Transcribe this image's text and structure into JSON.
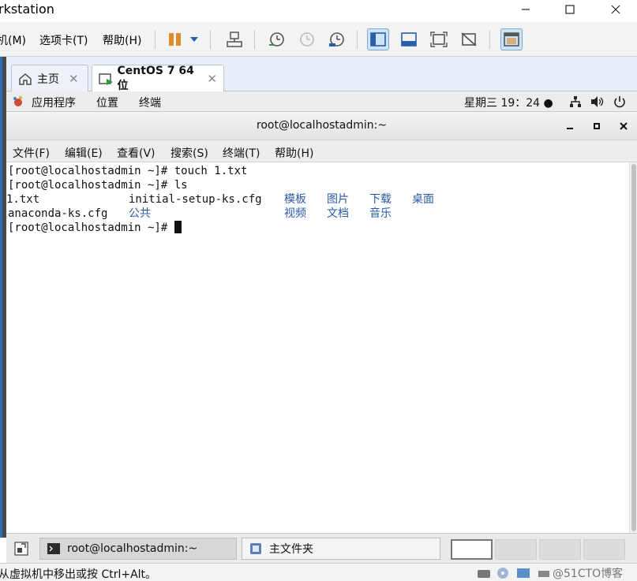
{
  "window": {
    "title": "rkstation"
  },
  "vm_menu": [
    "机(M)",
    "选项卡(T)",
    "帮助(H)"
  ],
  "tabs": [
    {
      "label": "主页"
    },
    {
      "label": "CentOS 7 64 位"
    }
  ],
  "gnome_top": {
    "apps": "应用程序",
    "places": "位置",
    "terminal": "终端",
    "clock": "星期三 19：24 ●"
  },
  "terminal": {
    "title": "root@localhostadmin:~",
    "menu": [
      "文件(F)",
      "编辑(E)",
      "查看(V)",
      "搜索(S)",
      "终端(T)",
      "帮助(H)"
    ],
    "lines": [
      {
        "prompt": "[root@localhostadmin ~]# ",
        "cmd": "touch 1.txt"
      },
      {
        "prompt": "[root@localhostadmin ~]# ",
        "cmd": "ls"
      }
    ],
    "ls_output": {
      "row1": {
        "a": "1.txt",
        "b": "initial-setup-ks.cfg",
        "dirs": [
          "模板",
          "图片",
          "下载",
          "桌面"
        ]
      },
      "row2": {
        "a": "anaconda-ks.cfg",
        "b": "公共",
        "dirs": [
          "视频",
          "文档",
          "音乐"
        ]
      }
    },
    "final_prompt": "[root@localhostadmin ~]# "
  },
  "taskbar": {
    "items": [
      {
        "label": "root@localhostadmin:~"
      },
      {
        "label": "主文件夹"
      }
    ]
  },
  "status": {
    "message": "从虚拟机中移出或按 Ctrl+Alt。",
    "watermark": "@51CTO博客"
  }
}
